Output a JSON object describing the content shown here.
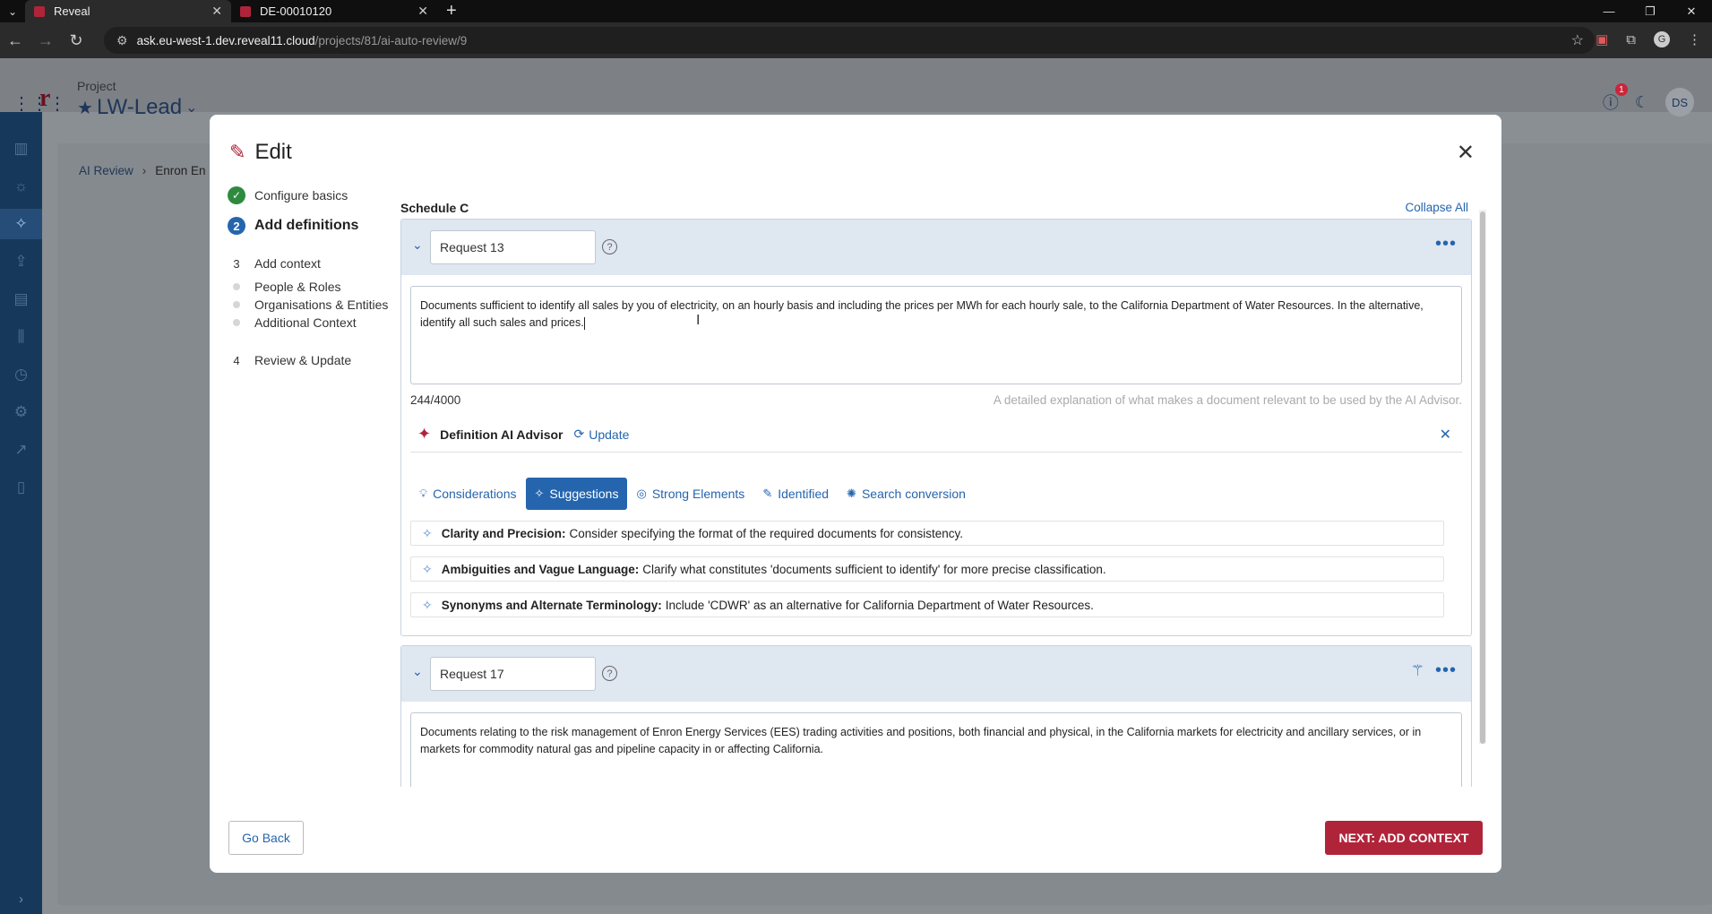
{
  "browser": {
    "tabs": [
      {
        "title": "Reveal",
        "active": true
      },
      {
        "title": "DE-00010120",
        "active": false
      }
    ],
    "url_host": "ask.eu-west-1.dev.reveal11.cloud",
    "url_path": "/projects/81/ai-auto-review/9",
    "profile_initial": "G"
  },
  "header": {
    "project_label": "Project",
    "project_name": "LW-Lead",
    "help_badge": "1",
    "user_initials": "DS"
  },
  "breadcrumb": {
    "root": "AI Review",
    "current": "Enron En"
  },
  "modal": {
    "title": "Edit",
    "steps": [
      {
        "num": "✓",
        "label": "Configure basics"
      },
      {
        "num": "2",
        "label": "Add definitions"
      },
      {
        "num": "3",
        "label": "Add context"
      },
      {
        "num": "4",
        "label": "Review & Update"
      }
    ],
    "substeps": [
      "People & Roles",
      "Organisations & Entities",
      "Additional Context"
    ],
    "section_title": "Schedule C",
    "collapse_all": "Collapse All",
    "requests": [
      {
        "name": "Request 13",
        "text": "Documents sufficient to identify all sales by you of electricity, on an hourly basis and including the prices per MWh for each hourly sale, to the California Department of Water Resources. In the alternative, identify all such sales and prices.",
        "counter": "244/4000",
        "hint": "A detailed explanation of what makes a document relevant to be used by the AI Advisor."
      },
      {
        "name": "Request 17",
        "text": "Documents relating to the risk management of Enron Energy Services (EES) trading activities and positions, both financial and physical, in the California markets for electricity and ancillary services, or in markets for commodity natural gas and pipeline capacity in or affecting California."
      }
    ],
    "advisor": {
      "title": "Definition AI Advisor",
      "update": "Update",
      "tabs": [
        "Considerations",
        "Suggestions",
        "Strong Elements",
        "Identified",
        "Search conversion"
      ],
      "active_tab": "Suggestions",
      "suggestions": [
        {
          "label": "Clarity and Precision:",
          "text": "Consider specifying the format of the required documents for consistency."
        },
        {
          "label": "Ambiguities and Vague Language:",
          "text": "Clarify what constitutes 'documents sufficient to identify' for more precise classification."
        },
        {
          "label": "Synonyms and Alternate Terminology:",
          "text": "Include 'CDWR' as an alternative for California Department of Water Resources."
        }
      ]
    },
    "go_back": "Go Back",
    "next": "NEXT: ADD CONTEXT"
  },
  "colors": {
    "brand_red": "#b0243a",
    "primary_blue": "#2565ae",
    "sidebar": "#16385a",
    "success_green": "#2e8b3e"
  }
}
